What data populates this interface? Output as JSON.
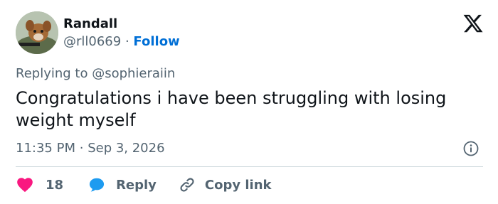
{
  "author": {
    "name": "Randall",
    "handle": "@rll0669",
    "separator": "·",
    "follow_label": "Follow"
  },
  "reply_context": "Replying to @sophieraiin",
  "tweet_text": "Congratulations i have been struggling with losing weight myself",
  "timestamp": {
    "time": "11:35 PM",
    "separator": "·",
    "date": "Sep 3, 2026"
  },
  "actions": {
    "like_count": "18",
    "reply_label": "Reply",
    "copy_link_label": "Copy link"
  },
  "colors": {
    "like": "#f91880",
    "reply": "#1d9bf0",
    "follow": "#006fd6",
    "muted": "#536471"
  },
  "icons": [
    "x-logo-icon",
    "info-icon",
    "heart-icon",
    "speech-bubble-icon",
    "link-icon"
  ]
}
